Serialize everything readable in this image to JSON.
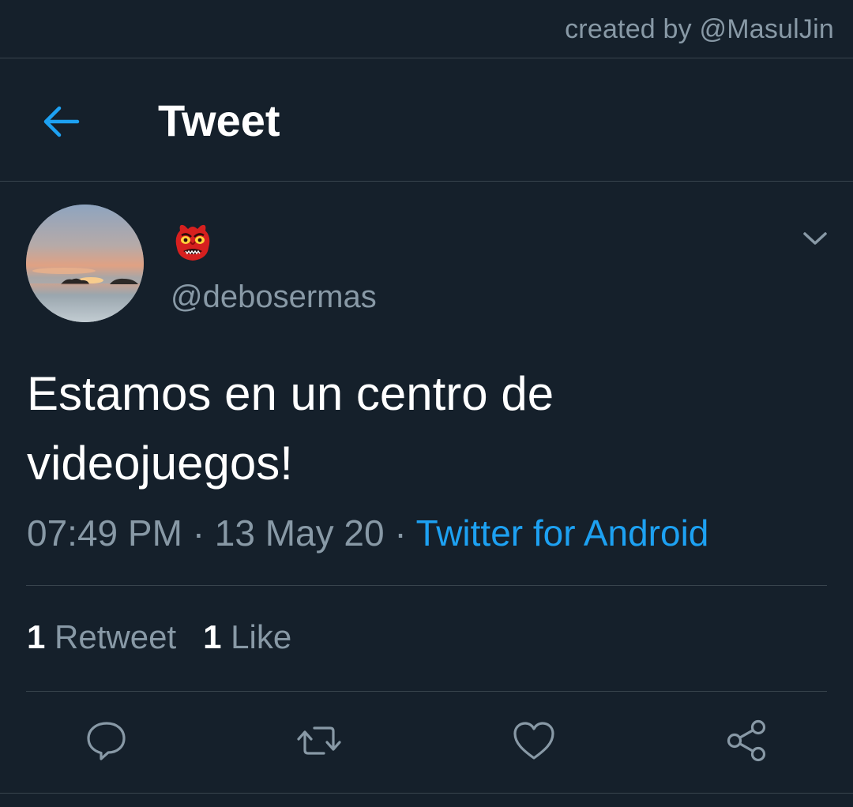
{
  "credit": {
    "text": "created by @MasulJin"
  },
  "header": {
    "back_icon": "arrow-left-icon",
    "title": "Tweet"
  },
  "tweet": {
    "avatar_icon": "sunset-profile-photo",
    "display_name_icon": "japanese-goblin-emoji",
    "handle": "@debosermas",
    "menu_icon": "chevron-down-icon",
    "text": "Estamos en un centro de videojuegos!",
    "time": "07:49 PM",
    "separator": "·",
    "date": "13 May 20",
    "source": "Twitter for Android"
  },
  "stats": {
    "retweet_count": "1",
    "retweet_label": "Retweet",
    "like_count": "1",
    "like_label": "Like"
  },
  "actions": [
    {
      "icon": "reply-icon"
    },
    {
      "icon": "retweet-icon"
    },
    {
      "icon": "heart-icon"
    },
    {
      "icon": "share-icon"
    }
  ],
  "colors": {
    "background": "#15202b",
    "divider": "#38444d",
    "secondary_text": "#8899a6",
    "accent": "#1da1f2",
    "primary_text": "#ffffff"
  }
}
